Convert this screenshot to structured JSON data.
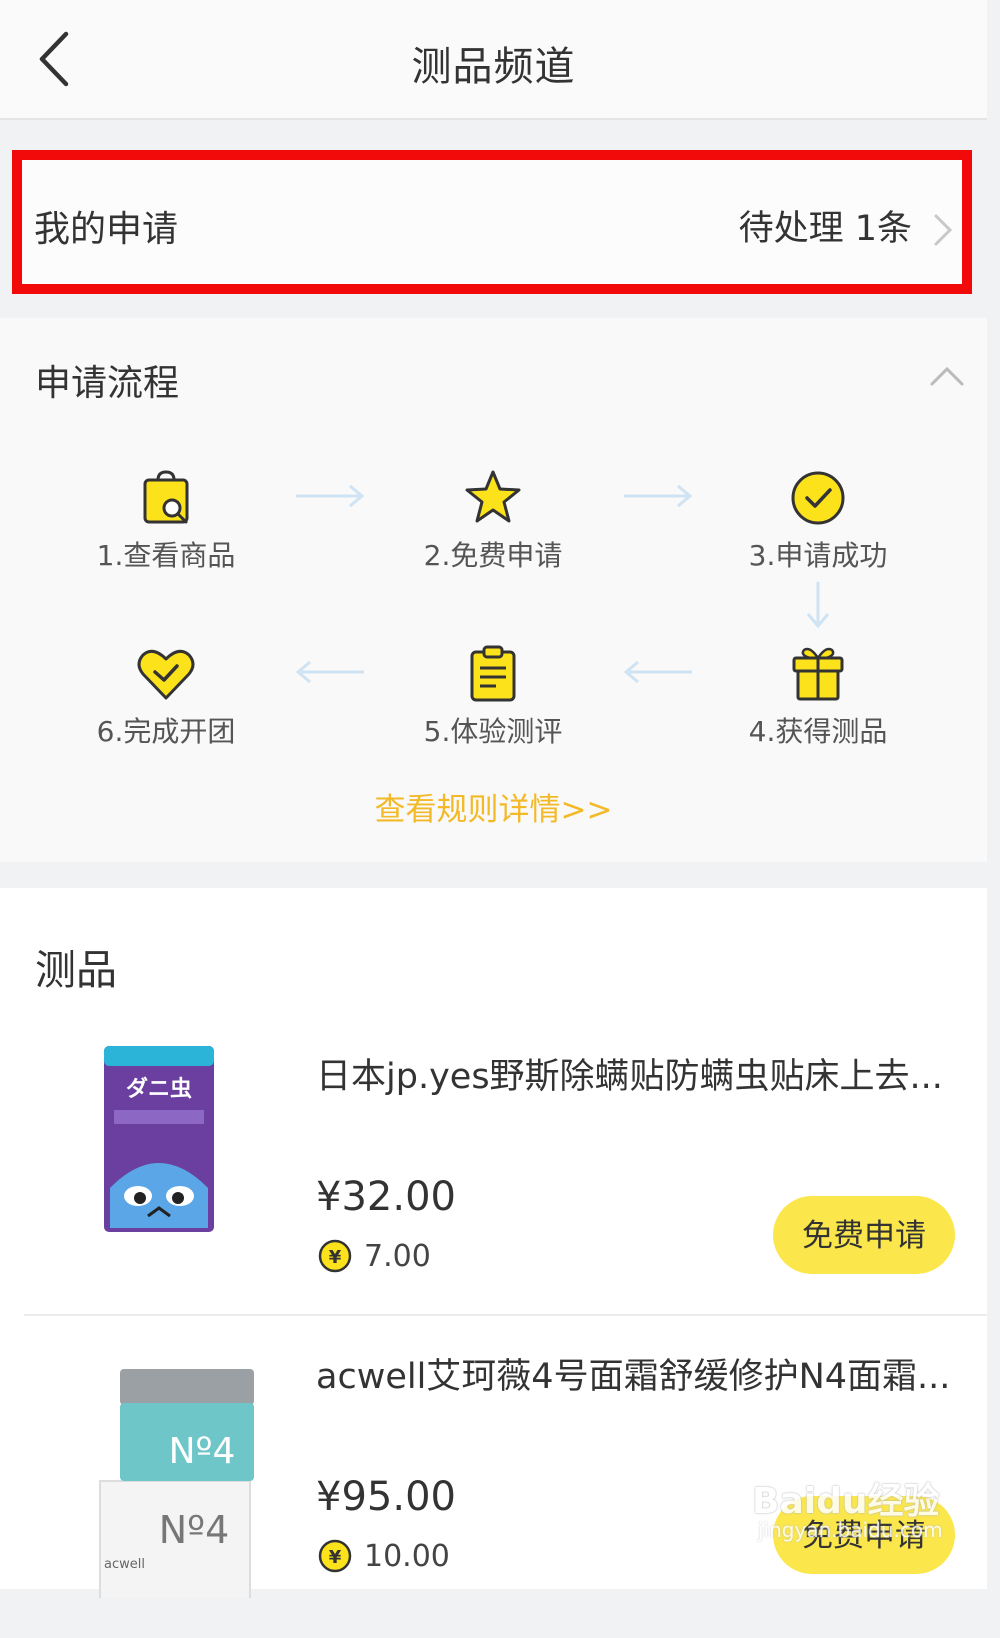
{
  "header": {
    "title": "测品频道",
    "back_icon": "chevron-left-icon"
  },
  "my_application": {
    "label": "我的申请",
    "pending": "待处理 1条",
    "chevron_icon": "chevron-right-icon",
    "highlight_color": "#f20a0a"
  },
  "process": {
    "title": "申请流程",
    "collapse_icon": "chevron-up-icon",
    "steps": [
      {
        "label": "1.查看商品",
        "icon": "shopping-bag-search-icon"
      },
      {
        "label": "2.免费申请",
        "icon": "star-icon"
      },
      {
        "label": "3.申请成功",
        "icon": "check-circle-icon"
      },
      {
        "label": "4.获得测品",
        "icon": "gift-icon"
      },
      {
        "label": "5.体验测评",
        "icon": "clipboard-icon"
      },
      {
        "label": "6.完成开团",
        "icon": "heart-icon"
      }
    ],
    "rules_link": "查看规则详情>>",
    "accent_color": "#f3b927",
    "icon_color": "#fbe21b"
  },
  "products": {
    "title": "测品",
    "items": [
      {
        "title": "日本jp.yes野斯除螨贴防螨虫贴床上去...",
        "price": "¥32.00",
        "coin_value": "7.00",
        "coin_icon": "yuan-coin-icon",
        "button": "免费申请",
        "image_text": "ダニ虫"
      },
      {
        "title": "acwell艾珂薇4号面霜舒缓修护N4面霜...",
        "price": "¥95.00",
        "coin_value": "10.00",
        "coin_icon": "yuan-coin-icon",
        "button": "免费申请",
        "image_text_top": "Nº4",
        "image_text_box": "Nº4",
        "image_brand": "acwell"
      }
    ],
    "button_color": "#fbe74b"
  },
  "watermark": {
    "text": "Baidu经验",
    "sub": "jingyan.baidu.com"
  }
}
